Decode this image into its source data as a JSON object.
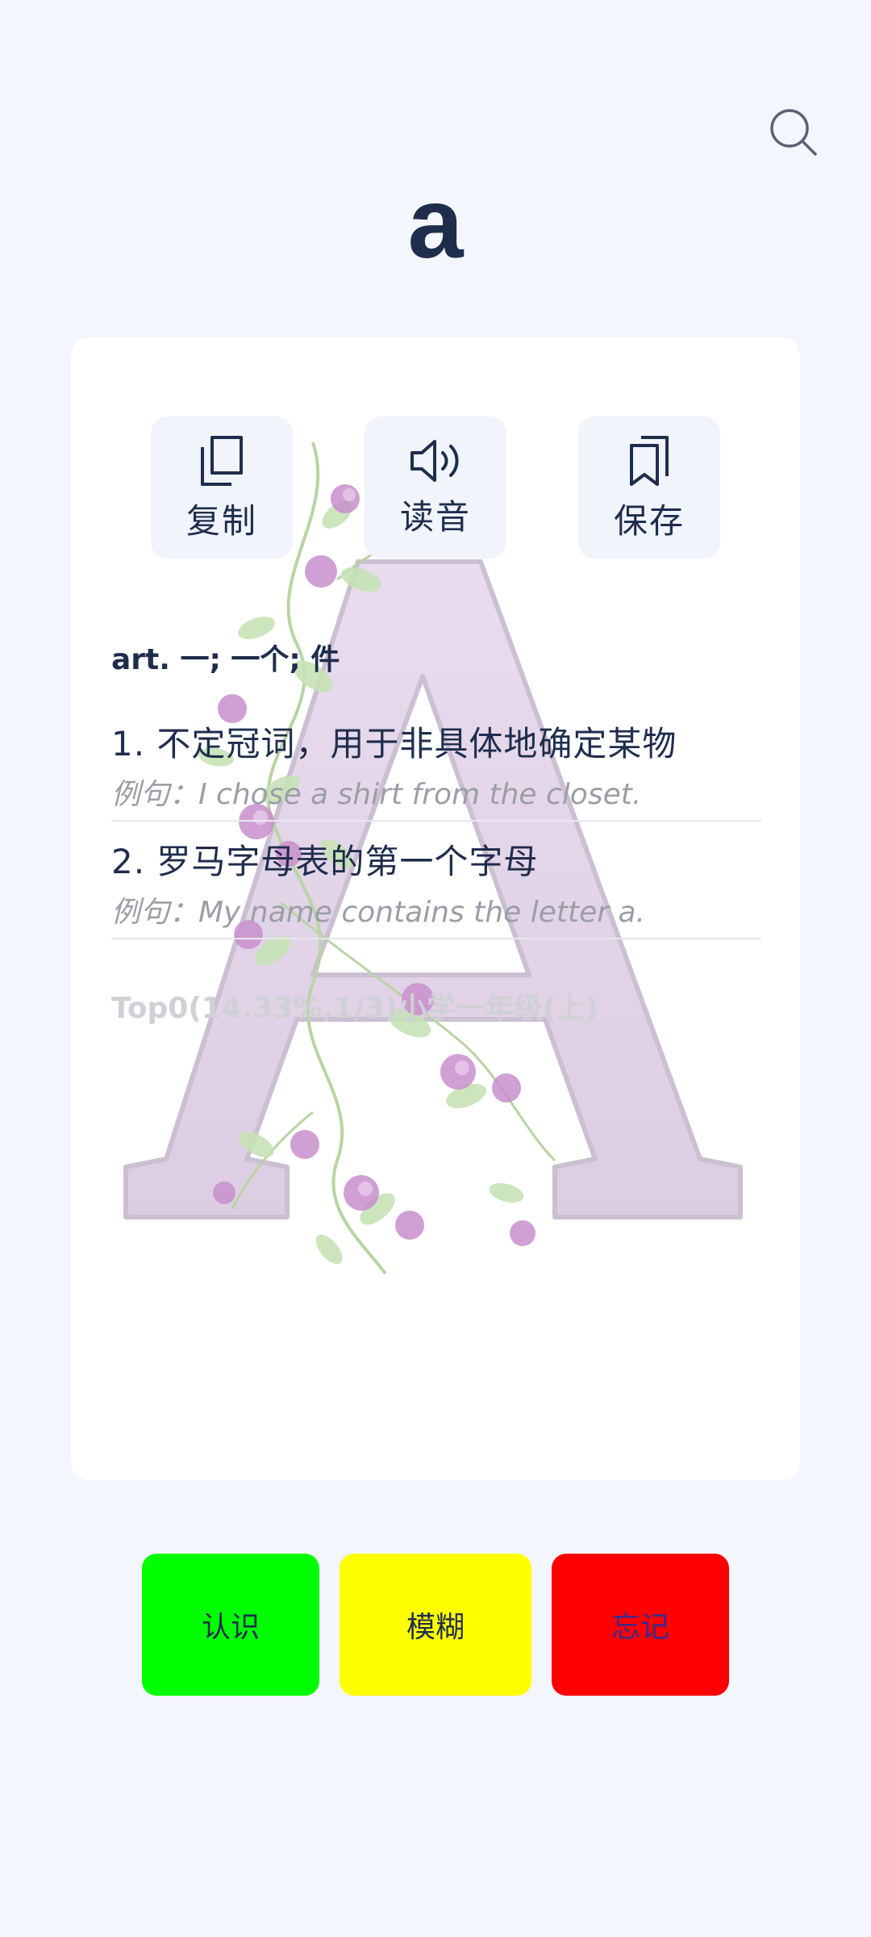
{
  "header": {
    "word": "a"
  },
  "icons": {
    "search": "search-icon",
    "copy": "copy-icon",
    "speaker": "speaker-icon",
    "bookmark": "bookmark-icon"
  },
  "actions": {
    "copy": "复制",
    "read": "读音",
    "save": "保存"
  },
  "entry": {
    "pos": "art. 一; 一个; 件",
    "definitions": [
      {
        "text": "1. 不定冠词，用于非具体地确定某物",
        "example": "例句：I chose a shirt from the closet."
      },
      {
        "text": "2. 罗马字母表的第一个字母",
        "example": "例句：My name contains the letter a."
      }
    ],
    "meta": "Top0(14.33%,1/3)小学一年级(上)"
  },
  "rating": {
    "know": "认识",
    "fuzzy": "模糊",
    "forget": "忘记"
  },
  "colors": {
    "background": "#f3f6fd",
    "card": "#ffffff",
    "text": "#1f2d4d",
    "know": "#00ff00",
    "fuzzy": "#ffff00",
    "forget": "#ff0000",
    "art_letter": "#e6d8ea"
  }
}
